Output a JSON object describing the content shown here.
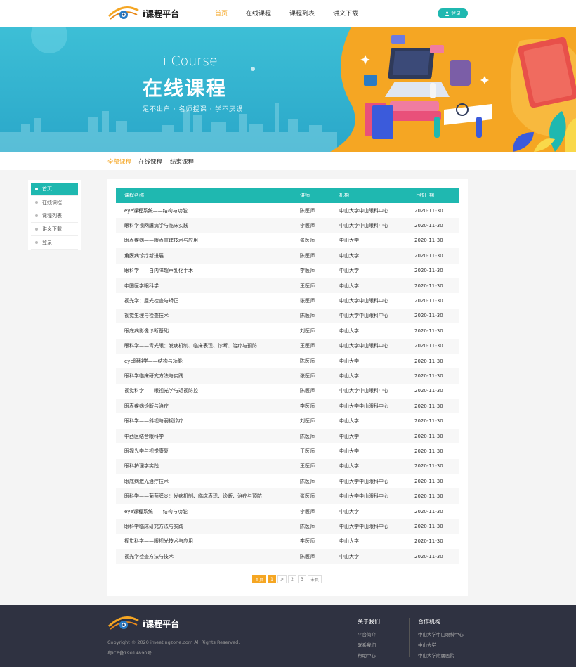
{
  "header": {
    "logo_text": "i课程平台",
    "nav": [
      {
        "label": "首页",
        "active": true
      },
      {
        "label": "在线课程",
        "active": false
      },
      {
        "label": "课程列表",
        "active": false
      },
      {
        "label": "讲义下载",
        "active": false
      }
    ],
    "login_label": "登录",
    "accent": "#1fb8b0",
    "highlight": "#f5a623"
  },
  "banner": {
    "en_title": "i Course",
    "title": "在线课程",
    "subtitle": "足不出户 · 名师授课 · 学不厌误"
  },
  "subnav": [
    "全部课程",
    "在线课程",
    "结束课程"
  ],
  "sidebar": {
    "items": [
      "首页",
      "在线课程",
      "课程列表",
      "讲义下载",
      "登录"
    ]
  },
  "table": {
    "headers": [
      "课程名称",
      "讲师",
      "机构",
      "上线日期"
    ],
    "rows": [
      [
        "eye课程系统——结构与功能",
        "陈医师",
        "中山大学中山眼科中心",
        "2020-11-30"
      ],
      [
        "眼科学视网膜病学与临床实践",
        "李医师",
        "中山大学中山眼科中心",
        "2020-11-30"
      ],
      [
        "眼表疾病——眼表重建技术与应用",
        "张医师",
        "中山大学",
        "2020-11-30"
      ],
      [
        "角膜病诊疗新进展",
        "陈医师",
        "中山大学",
        "2020-11-30"
      ],
      [
        "眼科学——白内障超声乳化手术",
        "李医师",
        "中山大学",
        "2020-11-30"
      ],
      [
        "中国医学眼科学",
        "王医师",
        "中山大学",
        "2020-11-30"
      ],
      [
        "视光学：屈光检查与矫正",
        "张医师",
        "中山大学中山眼科中心",
        "2020-11-30"
      ],
      [
        "视觉生理与检查技术",
        "陈医师",
        "中山大学中山眼科中心",
        "2020-11-30"
      ],
      [
        "眼底病影像诊断基础",
        "刘医师",
        "中山大学",
        "2020-11-30"
      ],
      [
        "眼科学——青光眼：发病机制、临床表现、诊断、治疗与预防",
        "王医师",
        "中山大学中山眼科中心",
        "2020-11-30"
      ],
      [
        "eye眼科学——结构与功能",
        "陈医师",
        "中山大学",
        "2020-11-30"
      ],
      [
        "眼科学临床研究方法与实践",
        "张医师",
        "中山大学",
        "2020-11-30"
      ],
      [
        "视觉科学——眼视光学与近视防控",
        "陈医师",
        "中山大学中山眼科中心",
        "2020-11-30"
      ],
      [
        "眼表疾病诊断与治疗",
        "李医师",
        "中山大学中山眼科中心",
        "2020-11-30"
      ],
      [
        "眼科学——斜视与弱视诊疗",
        "刘医师",
        "中山大学",
        "2020-11-30"
      ],
      [
        "中西医结合眼科学",
        "陈医师",
        "中山大学",
        "2020-11-30"
      ],
      [
        "眼视光学与视觉康复",
        "王医师",
        "中山大学",
        "2020-11-30"
      ],
      [
        "眼科护理学实践",
        "王医师",
        "中山大学",
        "2020-11-30"
      ],
      [
        "眼底病激光治疗技术",
        "陈医师",
        "中山大学中山眼科中心",
        "2020-11-30"
      ],
      [
        "眼科学——葡萄膜炎：发病机制、临床表现、诊断、治疗与预防",
        "张医师",
        "中山大学中山眼科中心",
        "2020-11-30"
      ],
      [
        "eye课程系统——结构与功能",
        "李医师",
        "中山大学",
        "2020-11-30"
      ],
      [
        "眼科学临床研究方法与实践",
        "陈医师",
        "中山大学中山眼科中心",
        "2020-11-30"
      ],
      [
        "视觉科学——眼视光技术与应用",
        "李医师",
        "中山大学",
        "2020-11-30"
      ],
      [
        "视光学检查方法与技术",
        "陈医师",
        "中山大学",
        "2020-11-30"
      ]
    ]
  },
  "pager": [
    "首页",
    "1",
    ">",
    "2",
    "3",
    "末页"
  ],
  "footer": {
    "logo_text": "i课程平台",
    "copyright": "Copyright © 2020 imeetingzone.com All Rights Reserved.",
    "icp": "粤ICP备19014890号",
    "col1": {
      "title": "关于我们",
      "items": [
        "平台简介",
        "联系我们",
        "帮助中心"
      ]
    },
    "col2": {
      "title": "合作机构",
      "items": [
        "中山大学中山眼科中心",
        "中山大学",
        "中山大学附属医院"
      ]
    }
  }
}
